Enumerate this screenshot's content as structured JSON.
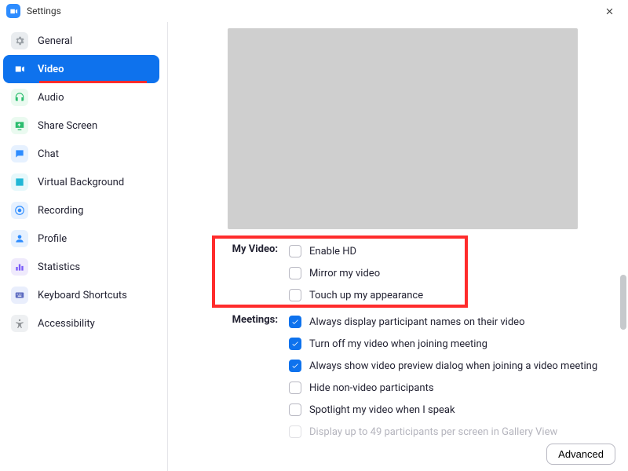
{
  "window": {
    "title": "Settings"
  },
  "sidebar": {
    "items": [
      {
        "label": "General"
      },
      {
        "label": "Video"
      },
      {
        "label": "Audio"
      },
      {
        "label": "Share Screen"
      },
      {
        "label": "Chat"
      },
      {
        "label": "Virtual Background"
      },
      {
        "label": "Recording"
      },
      {
        "label": "Profile"
      },
      {
        "label": "Statistics"
      },
      {
        "label": "Keyboard Shortcuts"
      },
      {
        "label": "Accessibility"
      }
    ]
  },
  "video": {
    "section1_label": "My Video:",
    "section2_label": "Meetings:",
    "opts1": [
      {
        "label": "Enable HD"
      },
      {
        "label": "Mirror my video"
      },
      {
        "label": "Touch up my appearance"
      }
    ],
    "opts2": [
      {
        "label": "Always display participant names on their video"
      },
      {
        "label": "Turn off my video when joining meeting"
      },
      {
        "label": "Always show video preview dialog when joining a video meeting"
      },
      {
        "label": "Hide non-video participants"
      },
      {
        "label": "Spotlight my video when I speak"
      },
      {
        "label": "Display up to 49 participants per screen in Gallery View"
      }
    ],
    "advanced_label": "Advanced"
  }
}
